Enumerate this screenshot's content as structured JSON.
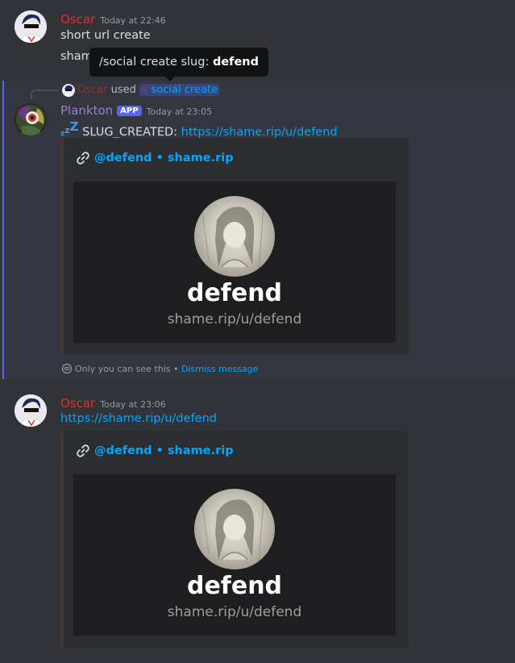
{
  "messages": [
    {
      "author": "Oscar",
      "timestamp": "Today at 22:46",
      "line1": "short url create",
      "line2": "sham"
    },
    {
      "reply": {
        "author": "Oscar",
        "used": "used",
        "command": "social create"
      },
      "author": "Plankton",
      "badge": "APP",
      "timestamp": "Today at 23:05",
      "zzz": "z",
      "zzz2": "Z",
      "prefix": "SLUG_CREATED:",
      "link": "https://shame.rip/u/defend",
      "embed": {
        "header": "@defend • shame.rip",
        "card_title": "defend",
        "card_sub": "shame.rip/u/defend"
      },
      "ephemeral_note": "Only you can see this",
      "separator": "•",
      "dismiss": "Dismiss message"
    },
    {
      "author": "Oscar",
      "timestamp": "Today at 23:06",
      "link": "https://shame.rip/u/defend",
      "embed": {
        "header": "@defend • shame.rip",
        "card_title": "defend",
        "card_sub": "shame.rip/u/defend"
      }
    }
  ],
  "tooltip": {
    "prefix": "/social create slug:",
    "value": "defend"
  },
  "colors": {
    "background": "#323339",
    "oscar": "#d9332c",
    "plankton": "#9a7fd1",
    "link": "#00a8fc",
    "badge": "#5865f2"
  },
  "icons": [
    "link-icon",
    "eye-icon",
    "slash-command-icon",
    "avatar-oscar",
    "avatar-plankton"
  ]
}
